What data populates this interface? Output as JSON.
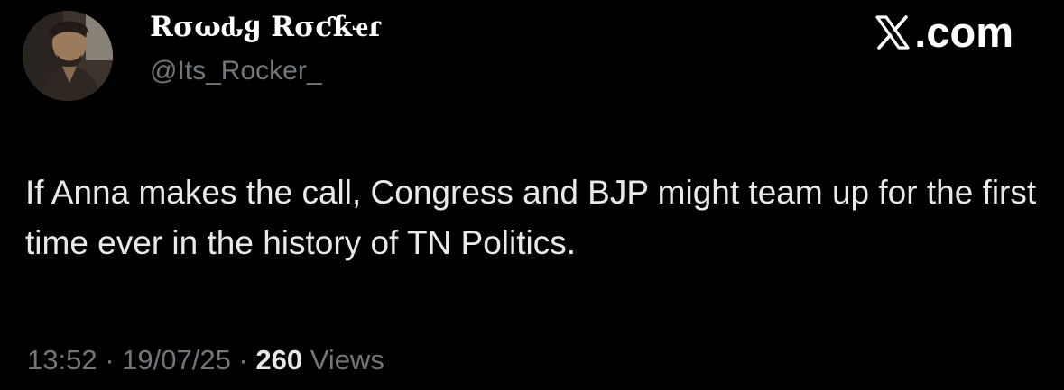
{
  "user": {
    "display_name": "Rσωԃყ Rσƈƙҽɾ",
    "handle": "@Its_Rocker_",
    "avatar_icon": "profile-photo"
  },
  "brand": {
    "label": ".com",
    "icon": "x-logo-icon"
  },
  "tweet": {
    "text": "If Anna makes the call, Congress and BJP might team up for the first time ever in the history of TN Politics."
  },
  "meta": {
    "time": "13:52",
    "separator1": " · ",
    "date": "19/07/25",
    "separator2": " · ",
    "views_count": "260",
    "views_label": " Views"
  },
  "colors": {
    "background": "#000000",
    "primary_text": "#e7e9ea",
    "secondary_text": "#71767b"
  }
}
